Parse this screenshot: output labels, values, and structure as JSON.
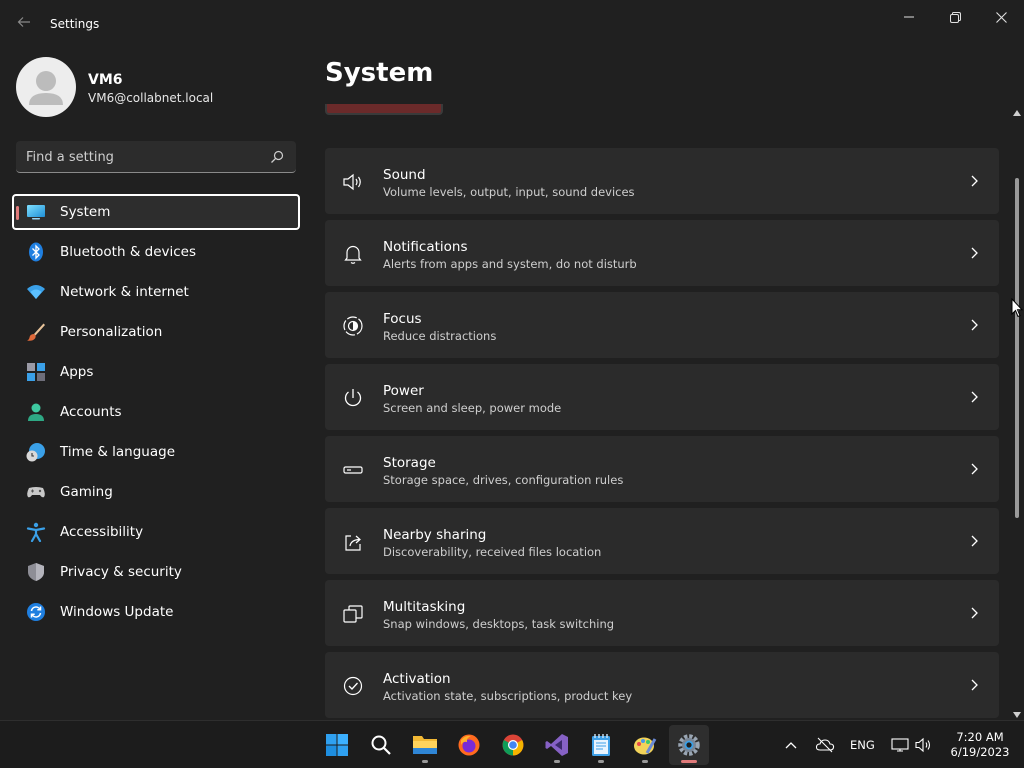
{
  "window": {
    "title": "Settings"
  },
  "profile": {
    "name": "VM6",
    "email": "VM6@collabnet.local"
  },
  "search": {
    "placeholder": "Find a setting",
    "value": ""
  },
  "nav": {
    "items": [
      {
        "label": "System",
        "icon": "system-icon",
        "active": true
      },
      {
        "label": "Bluetooth & devices",
        "icon": "bluetooth-icon"
      },
      {
        "label": "Network & internet",
        "icon": "wifi-icon"
      },
      {
        "label": "Personalization",
        "icon": "brush-icon"
      },
      {
        "label": "Apps",
        "icon": "apps-icon"
      },
      {
        "label": "Accounts",
        "icon": "person-icon"
      },
      {
        "label": "Time & language",
        "icon": "clock-globe-icon"
      },
      {
        "label": "Gaming",
        "icon": "gamepad-icon"
      },
      {
        "label": "Accessibility",
        "icon": "accessibility-icon"
      },
      {
        "label": "Privacy & security",
        "icon": "shield-icon"
      },
      {
        "label": "Windows Update",
        "icon": "update-icon"
      }
    ]
  },
  "main": {
    "title": "System",
    "cards": [
      {
        "title": "Sound",
        "desc": "Volume levels, output, input, sound devices",
        "icon": "speaker-icon"
      },
      {
        "title": "Notifications",
        "desc": "Alerts from apps and system, do not disturb",
        "icon": "bell-icon"
      },
      {
        "title": "Focus",
        "desc": "Reduce distractions",
        "icon": "focus-icon"
      },
      {
        "title": "Power",
        "desc": "Screen and sleep, power mode",
        "icon": "power-icon"
      },
      {
        "title": "Storage",
        "desc": "Storage space, drives, configuration rules",
        "icon": "storage-icon"
      },
      {
        "title": "Nearby sharing",
        "desc": "Discoverability, received files location",
        "icon": "share-icon"
      },
      {
        "title": "Multitasking",
        "desc": "Snap windows, desktops, task switching",
        "icon": "multitask-icon"
      },
      {
        "title": "Activation",
        "desc": "Activation state, subscriptions, product key",
        "icon": "check-circle-icon"
      }
    ]
  },
  "taskbar": {
    "apps": [
      "start-icon",
      "search-icon",
      "file-explorer-icon",
      "firefox-icon",
      "chrome-icon",
      "visual-studio-icon",
      "notepad-icon",
      "paint-icon",
      "settings-icon"
    ],
    "tray": {
      "language": "ENG",
      "time": "7:20 AM",
      "date": "6/19/2023"
    }
  },
  "colors": {
    "background": "#202020",
    "card": "#2b2b2b",
    "accent_indicator": "#e07a7a",
    "system_icon": "#4cc2ff"
  }
}
